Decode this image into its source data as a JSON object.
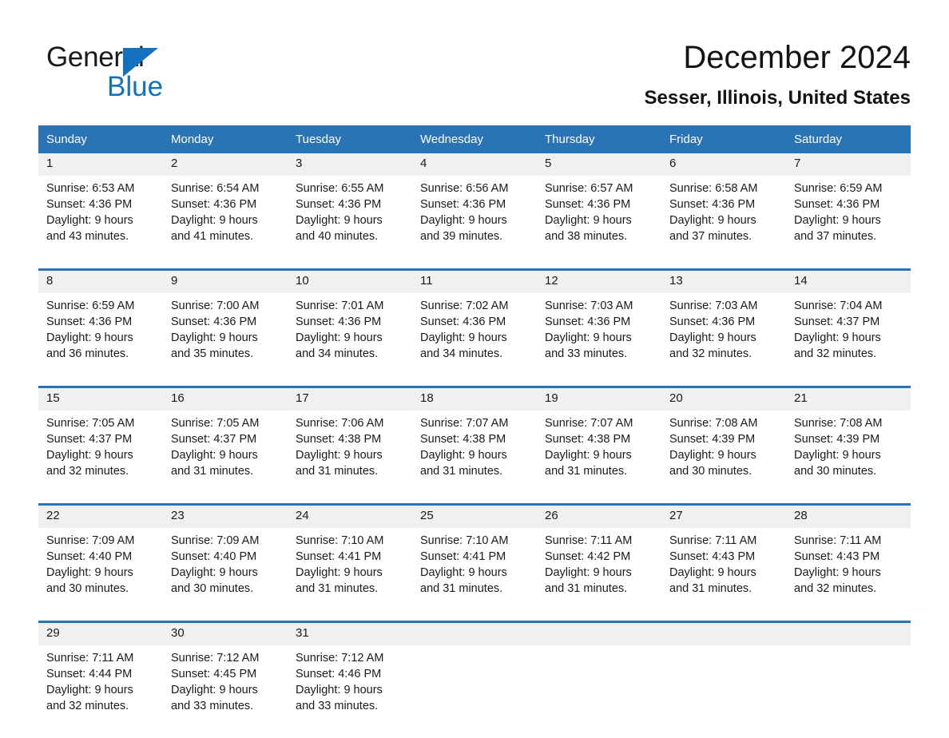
{
  "brand": {
    "name_part1": "General",
    "name_part2": "Blue",
    "primary_color": "#1471bd",
    "header_color": "#2a74b5"
  },
  "header": {
    "month_title": "December 2024",
    "location": "Sesser, Illinois, United States"
  },
  "calendar": {
    "weekday_headers": [
      "Sunday",
      "Monday",
      "Tuesday",
      "Wednesday",
      "Thursday",
      "Friday",
      "Saturday"
    ],
    "weeks": [
      {
        "days": [
          {
            "date": "1",
            "sunrise": "Sunrise: 6:53 AM",
            "sunset": "Sunset: 4:36 PM",
            "daylight_1": "Daylight: 9 hours",
            "daylight_2": "and 43 minutes."
          },
          {
            "date": "2",
            "sunrise": "Sunrise: 6:54 AM",
            "sunset": "Sunset: 4:36 PM",
            "daylight_1": "Daylight: 9 hours",
            "daylight_2": "and 41 minutes."
          },
          {
            "date": "3",
            "sunrise": "Sunrise: 6:55 AM",
            "sunset": "Sunset: 4:36 PM",
            "daylight_1": "Daylight: 9 hours",
            "daylight_2": "and 40 minutes."
          },
          {
            "date": "4",
            "sunrise": "Sunrise: 6:56 AM",
            "sunset": "Sunset: 4:36 PM",
            "daylight_1": "Daylight: 9 hours",
            "daylight_2": "and 39 minutes."
          },
          {
            "date": "5",
            "sunrise": "Sunrise: 6:57 AM",
            "sunset": "Sunset: 4:36 PM",
            "daylight_1": "Daylight: 9 hours",
            "daylight_2": "and 38 minutes."
          },
          {
            "date": "6",
            "sunrise": "Sunrise: 6:58 AM",
            "sunset": "Sunset: 4:36 PM",
            "daylight_1": "Daylight: 9 hours",
            "daylight_2": "and 37 minutes."
          },
          {
            "date": "7",
            "sunrise": "Sunrise: 6:59 AM",
            "sunset": "Sunset: 4:36 PM",
            "daylight_1": "Daylight: 9 hours",
            "daylight_2": "and 37 minutes."
          }
        ]
      },
      {
        "days": [
          {
            "date": "8",
            "sunrise": "Sunrise: 6:59 AM",
            "sunset": "Sunset: 4:36 PM",
            "daylight_1": "Daylight: 9 hours",
            "daylight_2": "and 36 minutes."
          },
          {
            "date": "9",
            "sunrise": "Sunrise: 7:00 AM",
            "sunset": "Sunset: 4:36 PM",
            "daylight_1": "Daylight: 9 hours",
            "daylight_2": "and 35 minutes."
          },
          {
            "date": "10",
            "sunrise": "Sunrise: 7:01 AM",
            "sunset": "Sunset: 4:36 PM",
            "daylight_1": "Daylight: 9 hours",
            "daylight_2": "and 34 minutes."
          },
          {
            "date": "11",
            "sunrise": "Sunrise: 7:02 AM",
            "sunset": "Sunset: 4:36 PM",
            "daylight_1": "Daylight: 9 hours",
            "daylight_2": "and 34 minutes."
          },
          {
            "date": "12",
            "sunrise": "Sunrise: 7:03 AM",
            "sunset": "Sunset: 4:36 PM",
            "daylight_1": "Daylight: 9 hours",
            "daylight_2": "and 33 minutes."
          },
          {
            "date": "13",
            "sunrise": "Sunrise: 7:03 AM",
            "sunset": "Sunset: 4:36 PM",
            "daylight_1": "Daylight: 9 hours",
            "daylight_2": "and 32 minutes."
          },
          {
            "date": "14",
            "sunrise": "Sunrise: 7:04 AM",
            "sunset": "Sunset: 4:37 PM",
            "daylight_1": "Daylight: 9 hours",
            "daylight_2": "and 32 minutes."
          }
        ]
      },
      {
        "days": [
          {
            "date": "15",
            "sunrise": "Sunrise: 7:05 AM",
            "sunset": "Sunset: 4:37 PM",
            "daylight_1": "Daylight: 9 hours",
            "daylight_2": "and 32 minutes."
          },
          {
            "date": "16",
            "sunrise": "Sunrise: 7:05 AM",
            "sunset": "Sunset: 4:37 PM",
            "daylight_1": "Daylight: 9 hours",
            "daylight_2": "and 31 minutes."
          },
          {
            "date": "17",
            "sunrise": "Sunrise: 7:06 AM",
            "sunset": "Sunset: 4:38 PM",
            "daylight_1": "Daylight: 9 hours",
            "daylight_2": "and 31 minutes."
          },
          {
            "date": "18",
            "sunrise": "Sunrise: 7:07 AM",
            "sunset": "Sunset: 4:38 PM",
            "daylight_1": "Daylight: 9 hours",
            "daylight_2": "and 31 minutes."
          },
          {
            "date": "19",
            "sunrise": "Sunrise: 7:07 AM",
            "sunset": "Sunset: 4:38 PM",
            "daylight_1": "Daylight: 9 hours",
            "daylight_2": "and 31 minutes."
          },
          {
            "date": "20",
            "sunrise": "Sunrise: 7:08 AM",
            "sunset": "Sunset: 4:39 PM",
            "daylight_1": "Daylight: 9 hours",
            "daylight_2": "and 30 minutes."
          },
          {
            "date": "21",
            "sunrise": "Sunrise: 7:08 AM",
            "sunset": "Sunset: 4:39 PM",
            "daylight_1": "Daylight: 9 hours",
            "daylight_2": "and 30 minutes."
          }
        ]
      },
      {
        "days": [
          {
            "date": "22",
            "sunrise": "Sunrise: 7:09 AM",
            "sunset": "Sunset: 4:40 PM",
            "daylight_1": "Daylight: 9 hours",
            "daylight_2": "and 30 minutes."
          },
          {
            "date": "23",
            "sunrise": "Sunrise: 7:09 AM",
            "sunset": "Sunset: 4:40 PM",
            "daylight_1": "Daylight: 9 hours",
            "daylight_2": "and 30 minutes."
          },
          {
            "date": "24",
            "sunrise": "Sunrise: 7:10 AM",
            "sunset": "Sunset: 4:41 PM",
            "daylight_1": "Daylight: 9 hours",
            "daylight_2": "and 31 minutes."
          },
          {
            "date": "25",
            "sunrise": "Sunrise: 7:10 AM",
            "sunset": "Sunset: 4:41 PM",
            "daylight_1": "Daylight: 9 hours",
            "daylight_2": "and 31 minutes."
          },
          {
            "date": "26",
            "sunrise": "Sunrise: 7:11 AM",
            "sunset": "Sunset: 4:42 PM",
            "daylight_1": "Daylight: 9 hours",
            "daylight_2": "and 31 minutes."
          },
          {
            "date": "27",
            "sunrise": "Sunrise: 7:11 AM",
            "sunset": "Sunset: 4:43 PM",
            "daylight_1": "Daylight: 9 hours",
            "daylight_2": "and 31 minutes."
          },
          {
            "date": "28",
            "sunrise": "Sunrise: 7:11 AM",
            "sunset": "Sunset: 4:43 PM",
            "daylight_1": "Daylight: 9 hours",
            "daylight_2": "and 32 minutes."
          }
        ]
      },
      {
        "days": [
          {
            "date": "29",
            "sunrise": "Sunrise: 7:11 AM",
            "sunset": "Sunset: 4:44 PM",
            "daylight_1": "Daylight: 9 hours",
            "daylight_2": "and 32 minutes."
          },
          {
            "date": "30",
            "sunrise": "Sunrise: 7:12 AM",
            "sunset": "Sunset: 4:45 PM",
            "daylight_1": "Daylight: 9 hours",
            "daylight_2": "and 33 minutes."
          },
          {
            "date": "31",
            "sunrise": "Sunrise: 7:12 AM",
            "sunset": "Sunset: 4:46 PM",
            "daylight_1": "Daylight: 9 hours",
            "daylight_2": "and 33 minutes."
          },
          {
            "date": "",
            "sunrise": "",
            "sunset": "",
            "daylight_1": "",
            "daylight_2": ""
          },
          {
            "date": "",
            "sunrise": "",
            "sunset": "",
            "daylight_1": "",
            "daylight_2": ""
          },
          {
            "date": "",
            "sunrise": "",
            "sunset": "",
            "daylight_1": "",
            "daylight_2": ""
          },
          {
            "date": "",
            "sunrise": "",
            "sunset": "",
            "daylight_1": "",
            "daylight_2": ""
          }
        ]
      }
    ]
  }
}
